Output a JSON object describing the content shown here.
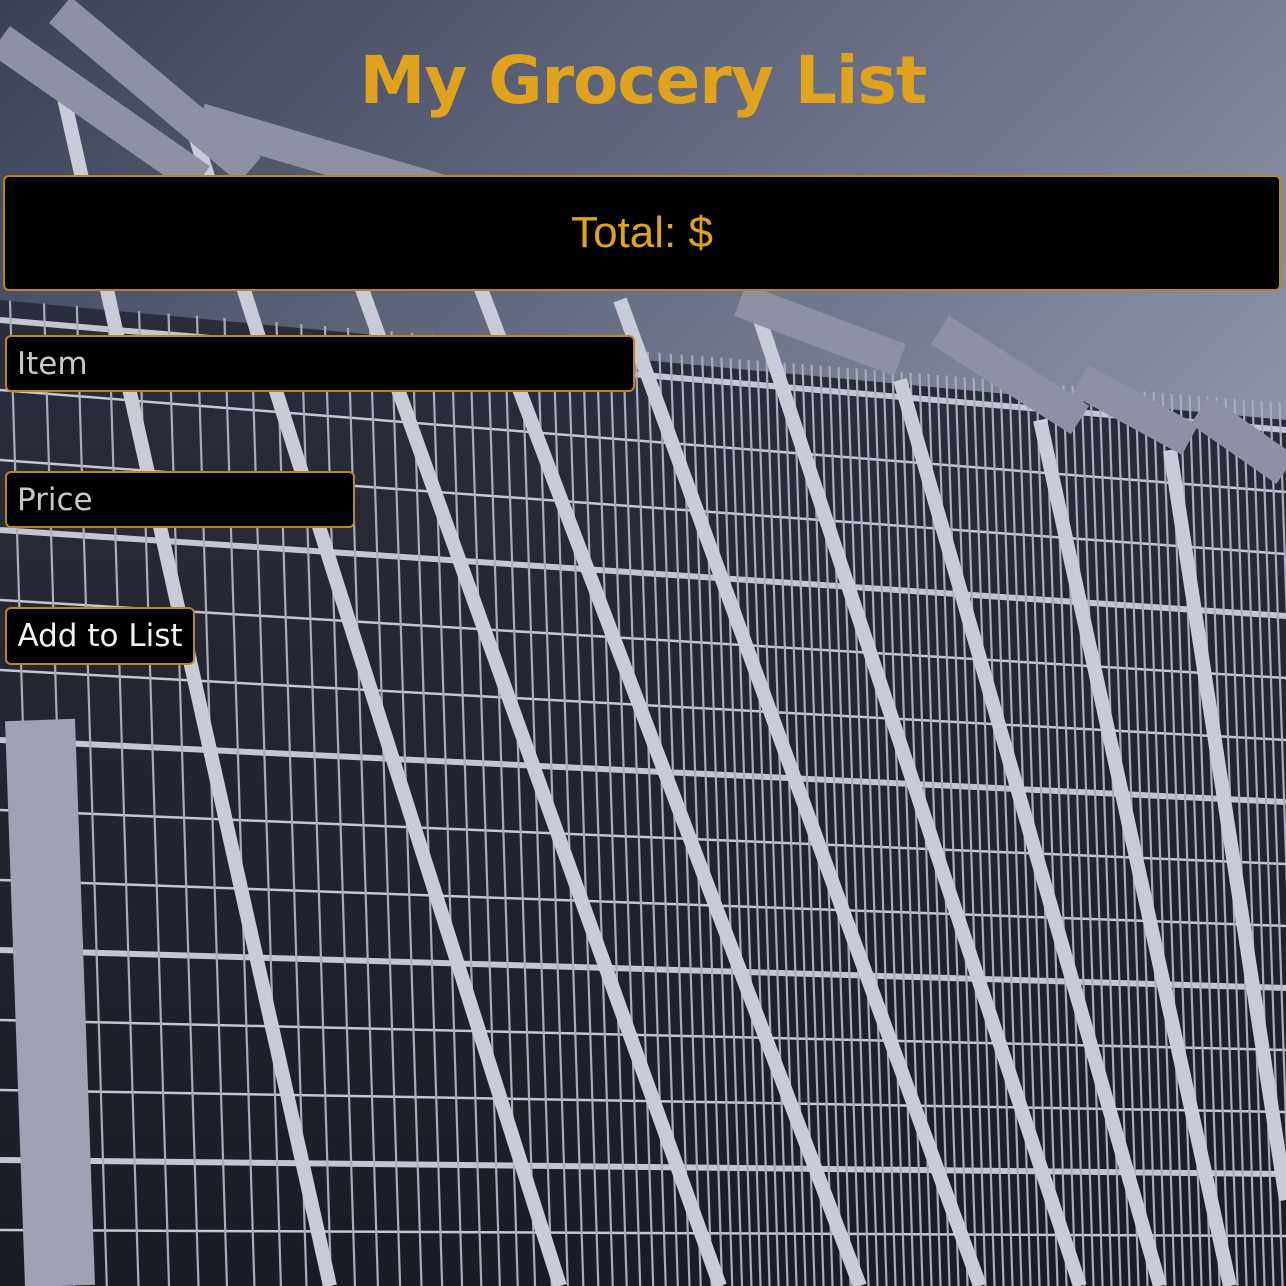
{
  "header": {
    "title": "My Grocery List"
  },
  "summary": {
    "total_label": "Total: $"
  },
  "form": {
    "item_placeholder": "Item",
    "price_placeholder": "Price",
    "add_label": "Add to List"
  },
  "colors": {
    "accent": "#e0a31f",
    "border": "#b8861c",
    "panel": "#000000"
  },
  "background": {
    "subject": "shopping-carts-photo"
  }
}
